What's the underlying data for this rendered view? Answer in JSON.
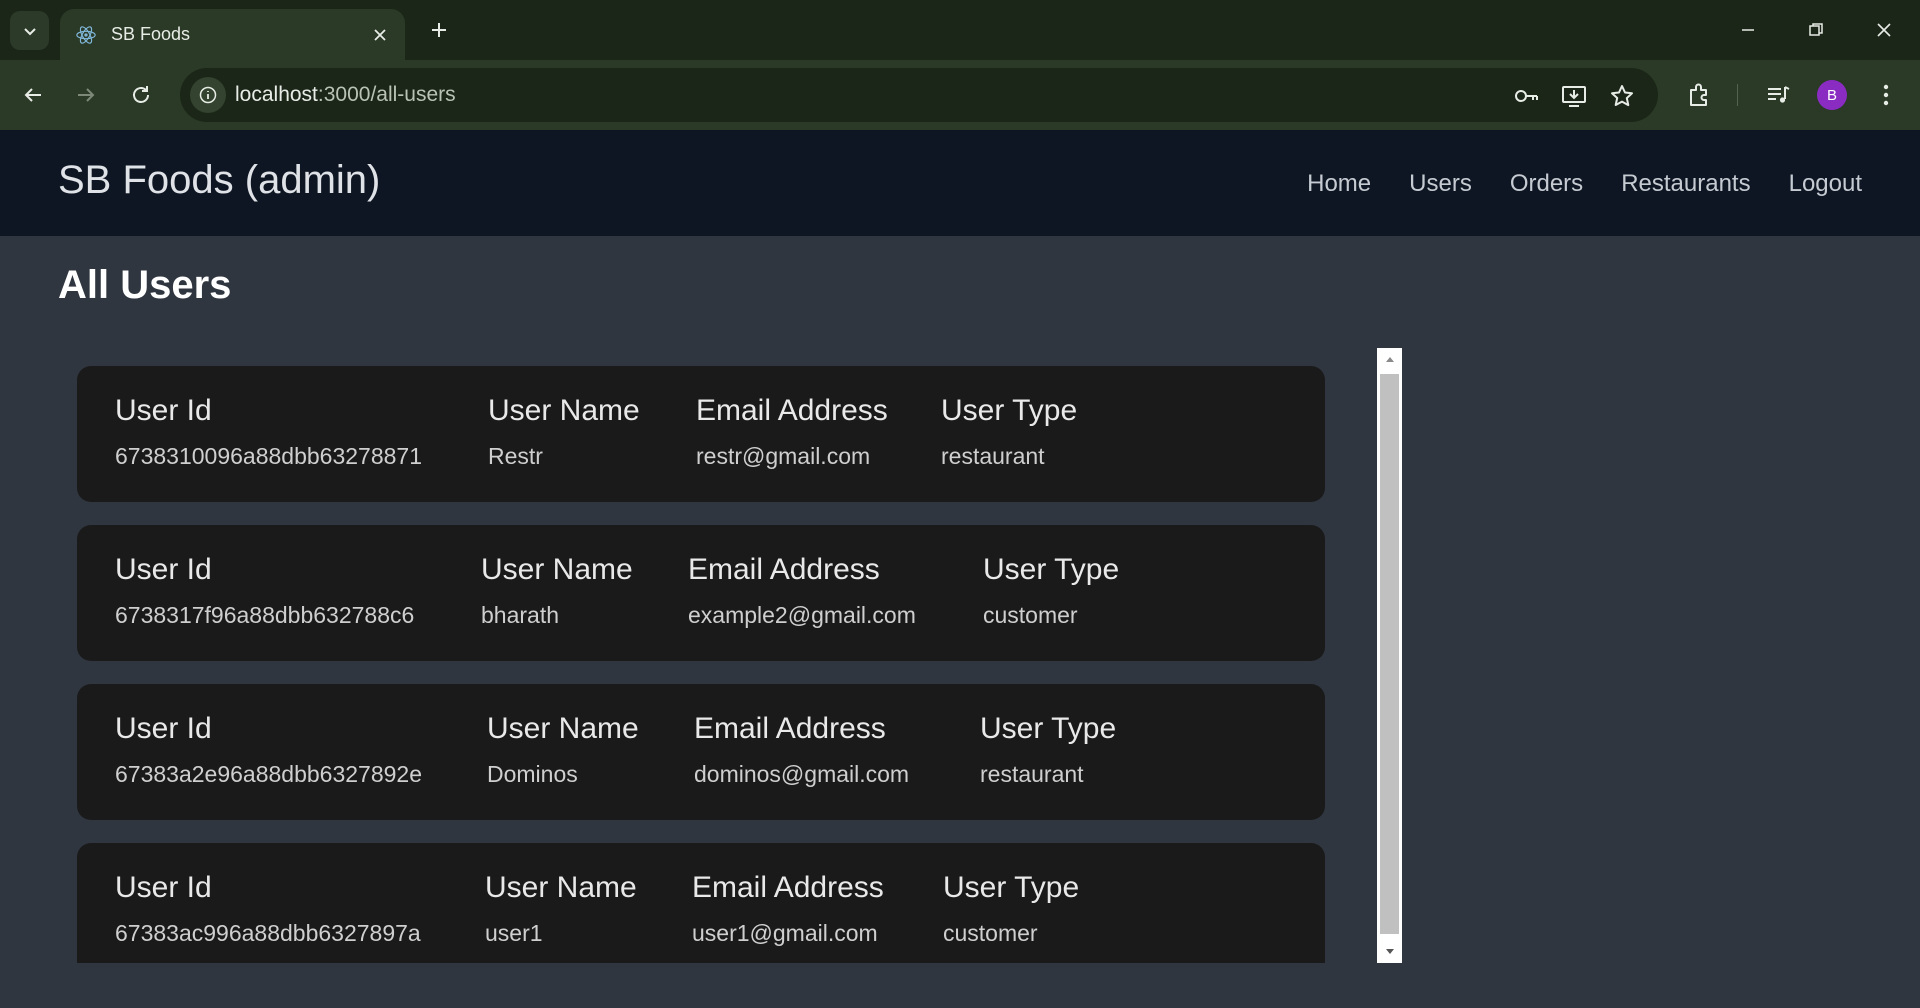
{
  "browser": {
    "tab_title": "SB Foods",
    "url_host": "localhost",
    "url_path": ":3000/all-users",
    "profile_initial": "B",
    "accent_color": "#8a2bc2"
  },
  "header": {
    "brand": "SB Foods (admin)",
    "nav": [
      "Home",
      "Users",
      "Orders",
      "Restaurants",
      "Logout"
    ]
  },
  "page": {
    "title": "All Users"
  },
  "users": [
    {
      "id_label": "User Id",
      "id": "6738310096a88dbb63278871",
      "name_label": "User Name",
      "name": "Restr",
      "email_label": "Email Address",
      "email": "restr@gmail.com",
      "type_label": "User Type",
      "type": "restaurant"
    },
    {
      "id_label": "User Id",
      "id": "6738317f96a88dbb632788c6",
      "name_label": "User Name",
      "name": "bharath",
      "email_label": "Email Address",
      "email": "example2@gmail.com",
      "type_label": "User Type",
      "type": "customer"
    },
    {
      "id_label": "User Id",
      "id": "67383a2e96a88dbb6327892e",
      "name_label": "User Name",
      "name": "Dominos",
      "email_label": "Email Address",
      "email": "dominos@gmail.com",
      "type_label": "User Type",
      "type": "restaurant"
    },
    {
      "id_label": "User Id",
      "id": "67383ac996a88dbb6327897a",
      "name_label": "User Name",
      "name": "user1",
      "email_label": "Email Address",
      "email": "user1@gmail.com",
      "type_label": "User Type",
      "type": "customer"
    }
  ]
}
